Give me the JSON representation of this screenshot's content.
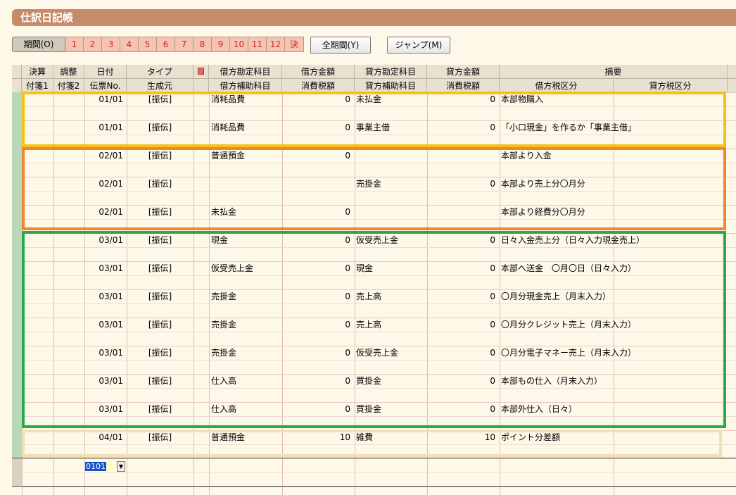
{
  "title": "仕訳日記帳",
  "toolbar": {
    "period_label": "期間(O)",
    "periods": [
      "1",
      "2",
      "3",
      "4",
      "5",
      "6",
      "7",
      "8",
      "9",
      "10",
      "11",
      "12",
      "決"
    ],
    "all_period_label": "全期間(Y)",
    "jump_label": "ジャンプ(M)"
  },
  "columns": {
    "row1": [
      "決算",
      "調整",
      "日付",
      "タイプ",
      "借方勘定科目",
      "借方金額",
      "貸方勘定科目",
      "貸方金額",
      "摘要"
    ],
    "row2": [
      "付箋1",
      "付箋2",
      "伝票No.",
      "生成元",
      "借方補助科目",
      "消費税額",
      "貸方補助科目",
      "消費税額",
      "借方税区分",
      "貸方税区分"
    ]
  },
  "entries": [
    {
      "date": "01/01",
      "type": "[振伝]",
      "debit_account": "消耗品費",
      "debit_amount": "0",
      "credit_account": "未払金",
      "credit_amount": "0",
      "memo": "本部物購入"
    },
    {
      "date": "01/01",
      "type": "[振伝]",
      "debit_account": "消耗品費",
      "debit_amount": "0",
      "credit_account": "事業主借",
      "credit_amount": "0",
      "memo": "「小口現金」を作るか「事業主借」"
    },
    {
      "date": "02/01",
      "type": "[振伝]",
      "debit_account": "普通預金",
      "debit_amount": "0",
      "credit_account": "",
      "credit_amount": "",
      "memo": "本部より入金"
    },
    {
      "date": "02/01",
      "type": "[振伝]",
      "debit_account": "",
      "debit_amount": "",
      "credit_account": "売掛金",
      "credit_amount": "0",
      "memo": "本部より売上分〇月分"
    },
    {
      "date": "02/01",
      "type": "[振伝]",
      "debit_account": "未払金",
      "debit_amount": "0",
      "credit_account": "",
      "credit_amount": "",
      "memo": "本部より経費分〇月分"
    },
    {
      "date": "03/01",
      "type": "[振伝]",
      "debit_account": "現金",
      "debit_amount": "0",
      "credit_account": "仮受売上金",
      "credit_amount": "0",
      "memo": "日々入金売上分（日々入力現金売上）"
    },
    {
      "date": "03/01",
      "type": "[振伝]",
      "debit_account": "仮受売上金",
      "debit_amount": "0",
      "credit_account": "現金",
      "credit_amount": "0",
      "memo": "本部へ送金　〇月〇日（日々入力）"
    },
    {
      "date": "03/01",
      "type": "[振伝]",
      "debit_account": "売掛金",
      "debit_amount": "0",
      "credit_account": "売上高",
      "credit_amount": "0",
      "memo": "〇月分現金売上（月末入力）"
    },
    {
      "date": "03/01",
      "type": "[振伝]",
      "debit_account": "売掛金",
      "debit_amount": "0",
      "credit_account": "売上高",
      "credit_amount": "0",
      "memo": "〇月分クレジット売上（月末入力）"
    },
    {
      "date": "03/01",
      "type": "[振伝]",
      "debit_account": "売掛金",
      "debit_amount": "0",
      "credit_account": "仮受売上金",
      "credit_amount": "0",
      "memo": "〇月分電子マネー売上（月末入力）"
    },
    {
      "date": "03/01",
      "type": "[振伝]",
      "debit_account": "仕入高",
      "debit_amount": "0",
      "credit_account": "買掛金",
      "credit_amount": "0",
      "memo": "本部もの仕入（月末入力）"
    },
    {
      "date": "03/01",
      "type": "[振伝]",
      "debit_account": "仕入高",
      "debit_amount": "0",
      "credit_account": "買掛金",
      "credit_amount": "0",
      "memo": "本部外仕入（日々）"
    },
    {
      "date": "04/01",
      "type": "[振伝]",
      "debit_account": "普通預金",
      "debit_amount": "10",
      "credit_account": "雑費",
      "credit_amount": "10",
      "memo": "ポイント分差額"
    }
  ],
  "new_entry": {
    "date_value": "0101"
  },
  "colors": {
    "yellow_box": "#f5c218",
    "orange_box": "#f2862c",
    "green_box": "#2aa84a",
    "beige_box": "#ece2b4"
  }
}
